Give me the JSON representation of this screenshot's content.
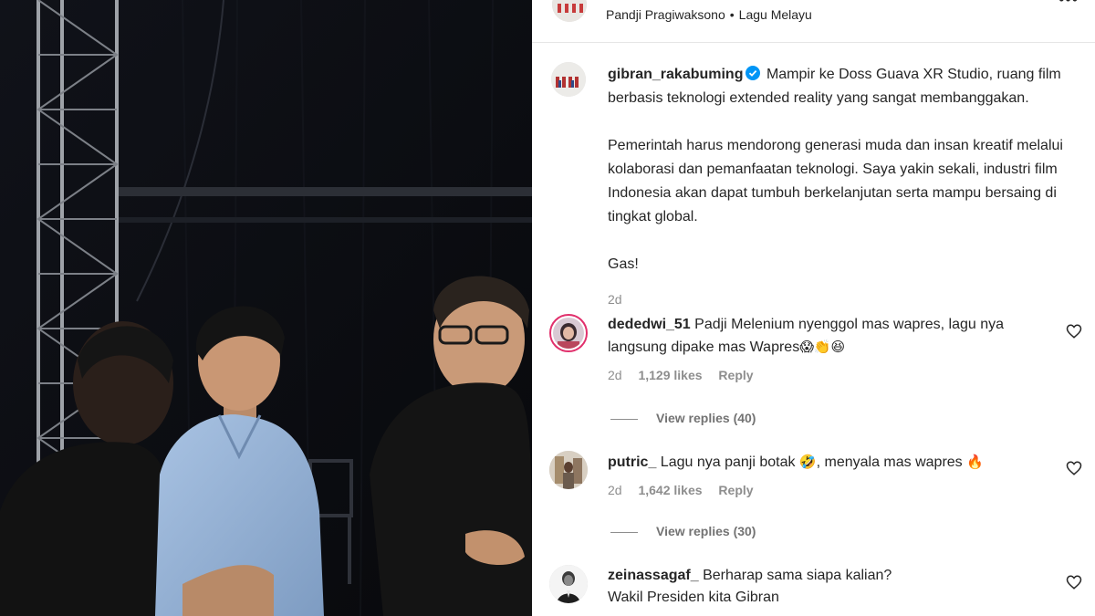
{
  "post": {
    "header": {
      "author": "Pandji Pragiwaksono",
      "audio": "Lagu Melayu",
      "more_label": "•••"
    },
    "caption": {
      "username": "gibran_rakabuming",
      "paragraph1": "Mampir ke Doss Guava XR Studio, ruang film berbasis teknologi extended reality yang sangat membanggakan.",
      "paragraph2": "Pemerintah harus mendorong generasi muda dan insan kreatif melalui kolaborasi dan pemanfaatan teknologi. Saya yakin sekali, industri film Indonesia akan dapat tumbuh berkelanjutan serta mampu bersaing di tingkat global.",
      "paragraph3": "Gas!",
      "time": "2d"
    }
  },
  "comments": [
    {
      "username": "dededwi_51",
      "text": "Padji Melenium nyenggol mas wapres, lagu nya langsung dipake mas Wapres",
      "emoji": "😱👏😆",
      "time": "2d",
      "likes": "1,129 likes",
      "reply": "Reply",
      "view_replies": "View replies (40)"
    },
    {
      "username": "putric_",
      "text": "Lagu nya panji botak",
      "emoji1": "🤣",
      "text2": ", menyala mas wapres",
      "emoji2": "🔥",
      "time": "2d",
      "likes": "1,642 likes",
      "reply": "Reply",
      "view_replies": "View replies (30)"
    },
    {
      "username": "zeinassagaf_",
      "text": "Berharap sama siapa kalian?",
      "text_line2": "Wakil Presiden kita Gibran"
    }
  ],
  "icons": {
    "verified_color": "#0095f6",
    "heart": "heart-outline-icon",
    "more": "more-horizontal-icon"
  }
}
